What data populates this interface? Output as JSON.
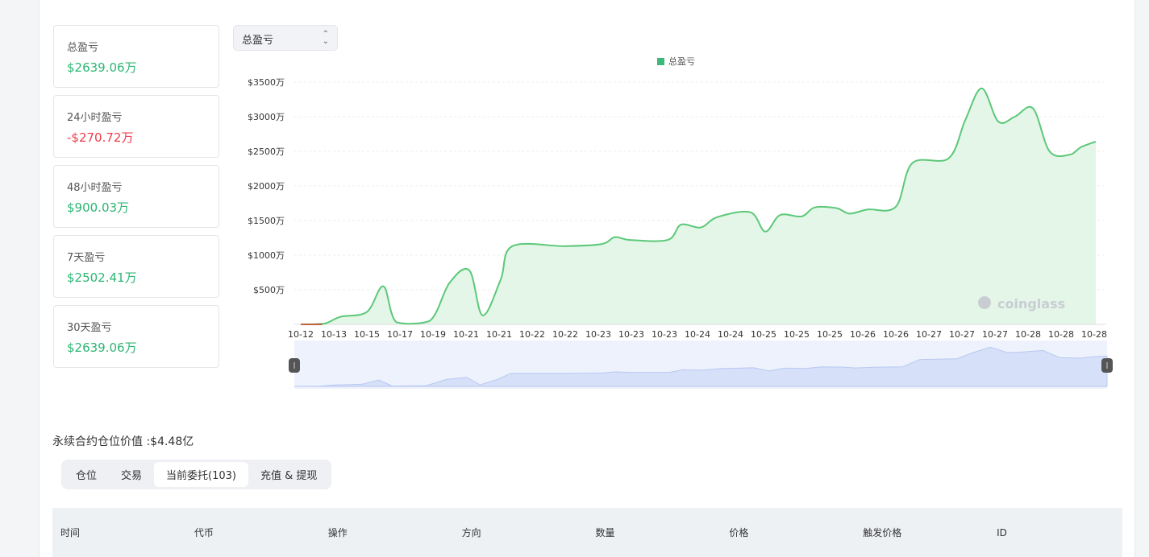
{
  "cards": [
    {
      "label": "总盈亏",
      "value": "$2639.06万",
      "sign": "pos"
    },
    {
      "label": "24小时盈亏",
      "value": "-$270.72万",
      "sign": "neg"
    },
    {
      "label": "48小时盈亏",
      "value": "$900.03万",
      "sign": "pos"
    },
    {
      "label": "7天盈亏",
      "value": "$2502.41万",
      "sign": "pos"
    },
    {
      "label": "30天盈亏",
      "value": "$2639.06万",
      "sign": "pos"
    }
  ],
  "select": {
    "value": "总盈亏"
  },
  "chart_data": {
    "type": "area",
    "legend": [
      "总盈亏"
    ],
    "legend_position": "top-center",
    "ylim": [
      0,
      3500
    ],
    "yticks": [
      "$500万",
      "$1000万",
      "$1500万",
      "$2000万",
      "$2500万",
      "$3000万",
      "$3500万"
    ],
    "ytick_values": [
      500,
      1000,
      1500,
      2000,
      2500,
      3000,
      3500
    ],
    "categories": [
      "10-12",
      "10-13",
      "10-15",
      "10-17",
      "10-19",
      "10-21",
      "10-21",
      "10-22",
      "10-22",
      "10-23",
      "10-23",
      "10-23",
      "10-24",
      "10-24",
      "10-25",
      "10-25",
      "10-25",
      "10-26",
      "10-26",
      "10-27",
      "10-27",
      "10-27",
      "10-28",
      "10-28",
      "10-28"
    ],
    "series": [
      {
        "name": "总盈亏",
        "color": "#5cc878",
        "points": [
          [
            0,
            0
          ],
          [
            0.7,
            10
          ],
          [
            1.2,
            110
          ],
          [
            2,
            180
          ],
          [
            2.5,
            550
          ],
          [
            2.9,
            30
          ],
          [
            3.9,
            50
          ],
          [
            4.5,
            600
          ],
          [
            5.1,
            780
          ],
          [
            5.5,
            130
          ],
          [
            6.05,
            650
          ],
          [
            6.4,
            1130
          ],
          [
            8,
            1130
          ],
          [
            9.1,
            1160
          ],
          [
            9.5,
            1260
          ],
          [
            9.95,
            1220
          ],
          [
            11.1,
            1220
          ],
          [
            11.5,
            1440
          ],
          [
            12.1,
            1400
          ],
          [
            12.6,
            1550
          ],
          [
            13.6,
            1620
          ],
          [
            14.05,
            1340
          ],
          [
            14.5,
            1580
          ],
          [
            15.15,
            1560
          ],
          [
            15.55,
            1690
          ],
          [
            16.2,
            1680
          ],
          [
            16.6,
            1600
          ],
          [
            17.15,
            1660
          ],
          [
            18,
            1700
          ],
          [
            18.5,
            2330
          ],
          [
            19.6,
            2400
          ],
          [
            20.1,
            2950
          ],
          [
            20.6,
            3410
          ],
          [
            21.1,
            2930
          ],
          [
            21.6,
            3000
          ],
          [
            22.15,
            3120
          ],
          [
            22.65,
            2500
          ],
          [
            23.25,
            2450
          ],
          [
            23.6,
            2560
          ],
          [
            24.05,
            2640
          ]
        ]
      }
    ],
    "watermark": "coinglass"
  },
  "position_value": "永续合约仓位价值 :$4.48亿",
  "tabs": [
    "仓位",
    "交易",
    "当前委托(103)",
    "充值 & 提现"
  ],
  "active_tab": 2,
  "table_headers": [
    "时间",
    "代币",
    "操作",
    "方向",
    "数量",
    "价格",
    "触发价格",
    "ID"
  ]
}
